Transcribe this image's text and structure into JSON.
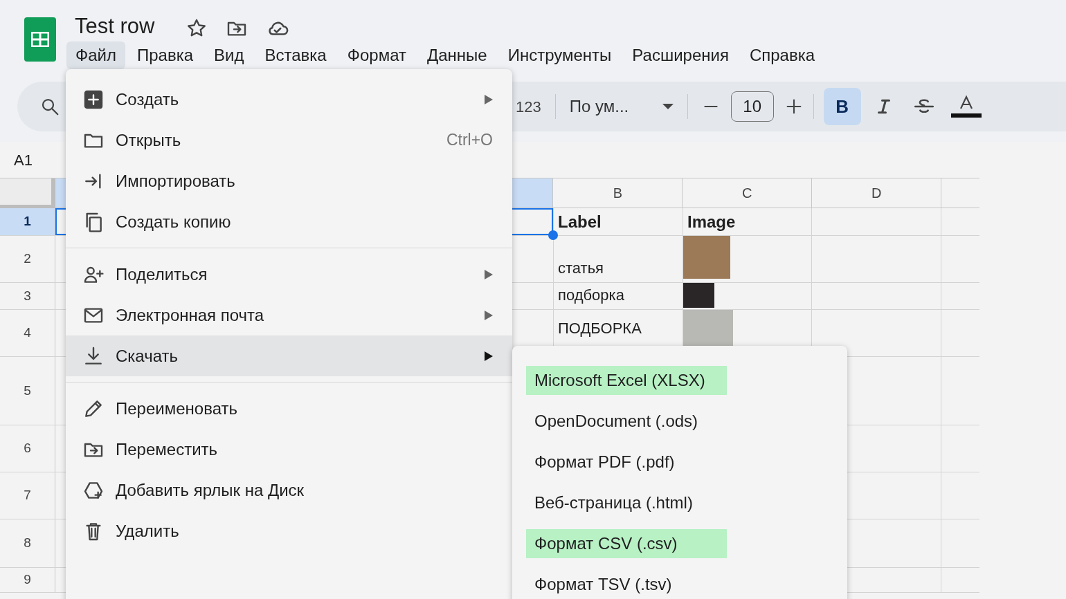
{
  "document": {
    "title": "Test row"
  },
  "menubar": [
    {
      "label": "Файл",
      "selected": true
    },
    {
      "label": "Правка",
      "selected": false
    },
    {
      "label": "Вид",
      "selected": false
    },
    {
      "label": "Вставка",
      "selected": false
    },
    {
      "label": "Формат",
      "selected": false
    },
    {
      "label": "Данные",
      "selected": false
    },
    {
      "label": "Инструменты",
      "selected": false
    },
    {
      "label": "Расширения",
      "selected": false
    },
    {
      "label": "Справка",
      "selected": false
    }
  ],
  "toolbar": {
    "number_format": "123",
    "font": "По ум...",
    "font_size": "10",
    "bold_button": {
      "label": "B",
      "selected": true
    }
  },
  "name_box": "A1",
  "sheet": {
    "columns": [
      "B",
      "C",
      "D"
    ],
    "rows": [
      {
        "number": "1",
        "selected": true,
        "label": "Label",
        "image": "Image",
        "kind": "header"
      },
      {
        "number": "2",
        "selected": false,
        "label": "статья",
        "kind": "photo"
      },
      {
        "number": "3",
        "selected": false,
        "label": "подборка",
        "kind": "photo"
      },
      {
        "number": "4",
        "selected": false,
        "label": "ПОДБОРКА",
        "kind": "photo"
      },
      {
        "number": "5",
        "selected": false,
        "kind": "empty"
      },
      {
        "number": "6",
        "selected": false,
        "kind": "empty"
      },
      {
        "number": "7",
        "selected": false,
        "kind": "empty"
      },
      {
        "number": "8",
        "selected": false,
        "kind": "empty"
      },
      {
        "number": "9",
        "selected": false,
        "kind": "empty"
      }
    ]
  },
  "file_menu": {
    "groups": [
      [
        {
          "label": "Создать",
          "submenu": true,
          "selected": false
        },
        {
          "label": "Открыть",
          "shortcut": "Ctrl+O",
          "submenu": false,
          "selected": false
        },
        {
          "label": "Импортировать",
          "submenu": false,
          "selected": false
        },
        {
          "label": "Создать копию",
          "submenu": false,
          "selected": false
        }
      ],
      [
        {
          "label": "Поделиться",
          "submenu": true,
          "selected": false
        },
        {
          "label": "Электронная почта",
          "submenu": true,
          "selected": false
        },
        {
          "label": "Скачать",
          "submenu": true,
          "selected": true
        }
      ],
      [
        {
          "label": "Переименовать",
          "submenu": false,
          "selected": false
        },
        {
          "label": "Переместить",
          "submenu": false,
          "selected": false
        },
        {
          "label": "Добавить ярлык на Диск",
          "submenu": false,
          "selected": false
        },
        {
          "label": "Удалить",
          "submenu": false,
          "selected": false
        }
      ]
    ]
  },
  "download_submenu": [
    {
      "label": "Microsoft Excel (XLSX)",
      "highlighted": true
    },
    {
      "label": "OpenDocument (.ods)",
      "highlighted": false
    },
    {
      "label": "Формат PDF (.pdf)",
      "highlighted": false
    },
    {
      "label": "Веб-страница (.html)",
      "highlighted": false
    },
    {
      "label": "Формат CSV (.csv)",
      "highlighted": true
    },
    {
      "label": "Формат TSV (.tsv)",
      "highlighted": false
    }
  ]
}
